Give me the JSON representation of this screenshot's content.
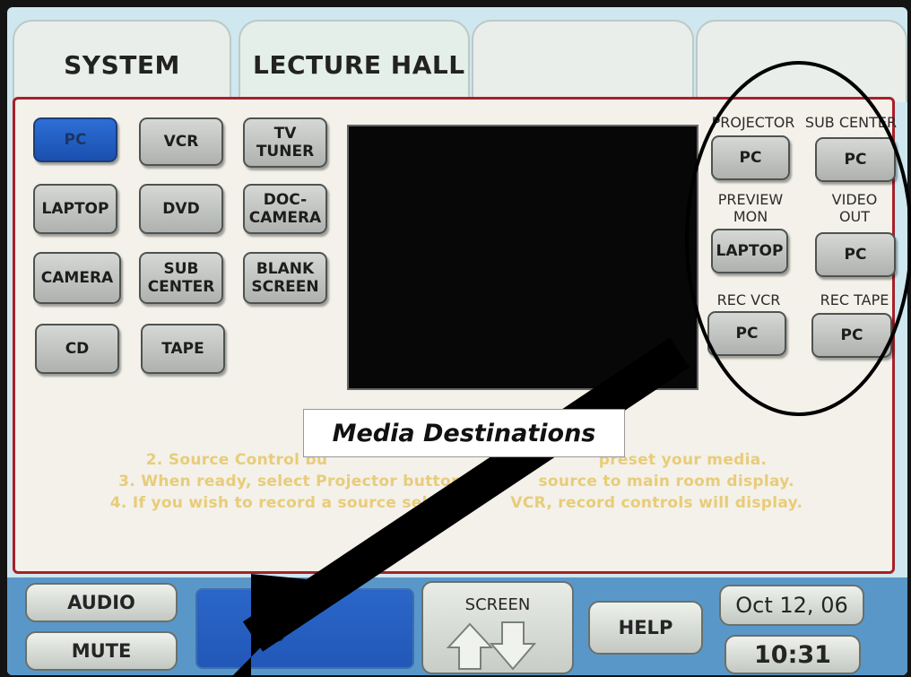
{
  "tabs": [
    "SYSTEM",
    "LECTURE HALL",
    "",
    ""
  ],
  "sources": [
    {
      "label": "PC",
      "selected": true
    },
    {
      "label": "VCR",
      "selected": false
    },
    {
      "label": "TV\nTUNER",
      "selected": false
    },
    {
      "label": "LAPTOP",
      "selected": false
    },
    {
      "label": "DVD",
      "selected": false
    },
    {
      "label": "DOC-\nCAMERA",
      "selected": false
    },
    {
      "label": "CAMERA",
      "selected": false
    },
    {
      "label": "SUB\nCENTER",
      "selected": false
    },
    {
      "label": "BLANK\nSCREEN",
      "selected": false
    },
    {
      "label": "CD",
      "selected": false
    },
    {
      "label": "TAPE",
      "selected": false
    }
  ],
  "destinations": [
    {
      "label": "PROJECTOR",
      "value": "PC"
    },
    {
      "label": "SUB CENTER",
      "value": "PC"
    },
    {
      "label": "PREVIEW\nMON",
      "value": "LAPTOP"
    },
    {
      "label": "VIDEO\nOUT",
      "value": "PC"
    },
    {
      "label": "REC VCR",
      "value": "PC"
    },
    {
      "label": "REC TAPE",
      "value": "PC"
    }
  ],
  "instructions": [
    "2. Source Control bu",
    "preset your media.",
    "3. When ready, select Projector button t",
    "source to main room display.",
    "4. If you wish to record a source selec",
    "VCR, record controls will display."
  ],
  "callout": "Media Destinations",
  "bottom": {
    "audio": "AUDIO",
    "mute": "MUTE",
    "volume_partial": "0",
    "screen": "SCREEN",
    "help": "HELP",
    "date": "Oct 12, 06",
    "time": "10:31"
  },
  "colors": {
    "selected_button": "#1f5bc2",
    "panel_border": "#a8202a",
    "instruction_text": "#e8cc7a",
    "bottom_bar": "#5a97c9"
  }
}
